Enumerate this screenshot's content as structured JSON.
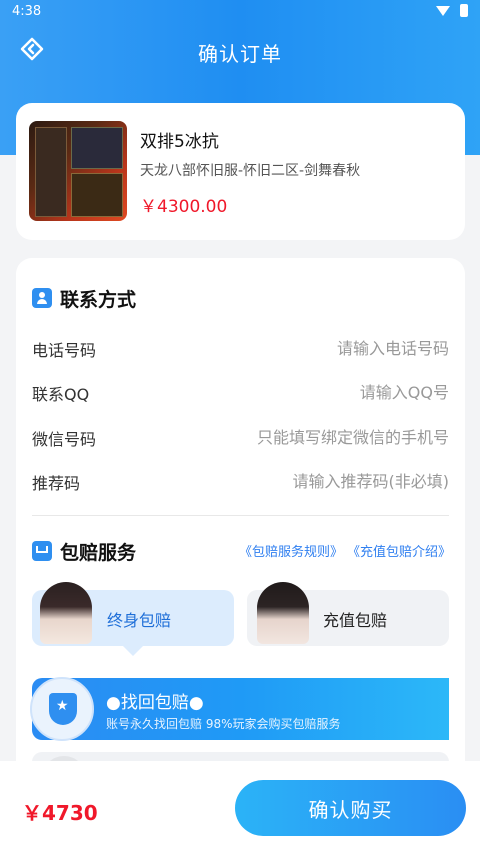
{
  "status_bar": {
    "time": "4:38"
  },
  "nav": {
    "title": "确认订单"
  },
  "product": {
    "title": "双排5冰抗",
    "subtitle": "天龙八部怀旧服-怀旧二区-剑舞春秋",
    "price": "￥4300.00"
  },
  "contact": {
    "section_title": "联系方式",
    "fields": [
      {
        "label": "电话号码",
        "placeholder": "请输入电话号码",
        "value": ""
      },
      {
        "label": "联系QQ",
        "placeholder": "请输入QQ号",
        "value": ""
      },
      {
        "label": "微信号码",
        "placeholder": "只能填写绑定微信的手机号",
        "value": ""
      },
      {
        "label": "推荐码",
        "placeholder": "请输入推荐码(非必填)",
        "value": ""
      }
    ]
  },
  "service": {
    "section_title": "包赔服务",
    "rules_link": "《包赔服务规则》",
    "intro_link": "《充值包赔介绍》",
    "options": [
      {
        "label": "终身包赔",
        "selected": true
      },
      {
        "label": "充值包赔",
        "selected": false
      }
    ],
    "banner": {
      "title": "●找回包赔●",
      "desc": "账号永久找回包赔 98%玩家会购买包赔服务"
    }
  },
  "bottom": {
    "total": "￥4730",
    "confirm_label": "确认购买"
  },
  "colors": {
    "accent": "#2f8ff0",
    "price": "#f0182a"
  }
}
